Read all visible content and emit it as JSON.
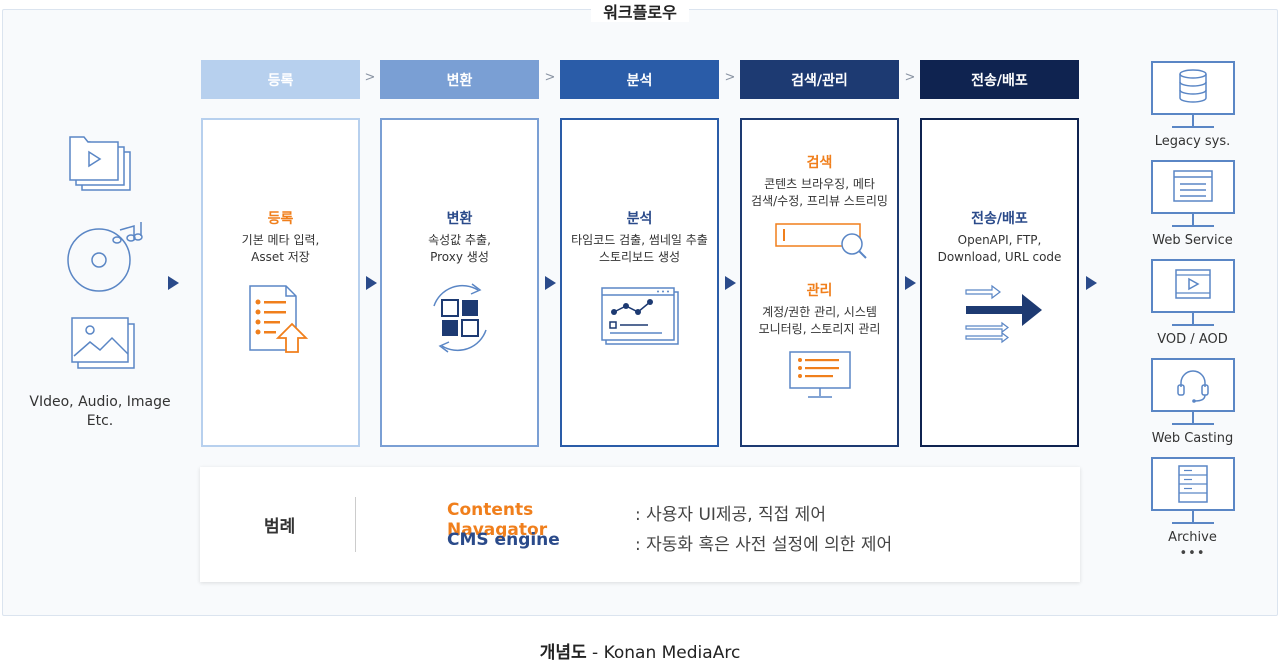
{
  "title": "워크플로우",
  "steps": [
    {
      "header": "등록",
      "title": "등록",
      "desc": "기본 메타 입력,\nAsset 저장"
    },
    {
      "header": "변환",
      "title": "변환",
      "desc": "속성값 추출,\nProxy 생성"
    },
    {
      "header": "분석",
      "title": "분석",
      "desc": "타임코드 검출, 썸네일 추출\n스토리보드 생성"
    },
    {
      "header": "검색/관리",
      "sub": [
        {
          "title": "검색",
          "desc": "콘텐츠 브라우징, 메타\n검색/수정, 프리뷰 스트리밍"
        },
        {
          "title": "관리",
          "desc": "계정/권한 관리, 시스템\n모니터링, 스토리지 관리"
        }
      ]
    },
    {
      "header": "전송/배포",
      "title": "전송/배포",
      "desc": "OpenAPI, FTP,\nDownload, URL code"
    }
  ],
  "source_label": "VIdeo, Audio, Image\nEtc.",
  "destinations": [
    "Legacy sys.",
    "Web Service",
    "VOD / AOD",
    "Web Casting",
    "Archive"
  ],
  "more": "•••",
  "legend": {
    "label": "범례",
    "items": [
      {
        "key": "Contents Navagator",
        "value": ": 사용자 UI제공, 직접 제어"
      },
      {
        "key": "CMS engine",
        "value": ": 자동화 혹은 사전 설정에 의한 제어"
      }
    ]
  },
  "footer": {
    "bold": "개념도",
    "rest": " - Konan MediaArc"
  },
  "colors": {
    "step1": "#b7d0ee",
    "step2": "#7a9fd4",
    "step3": "#2a5ca8",
    "step4": "#1d3a72",
    "step5": "#0f2350",
    "orange": "#f07f1c",
    "navy": "#2a4a8a"
  }
}
